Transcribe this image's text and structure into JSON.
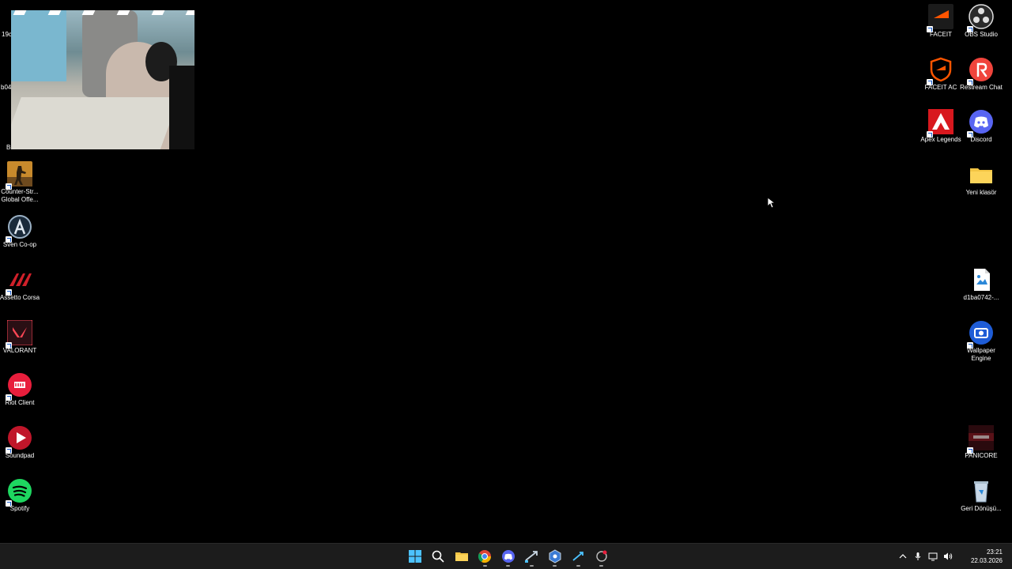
{
  "desktop": {
    "left_icons": [
      {
        "name": "counter-strike",
        "label": "Counter-Str... Global Offe..."
      },
      {
        "name": "sven-coop",
        "label": "Sven Co-op"
      },
      {
        "name": "assetto-corsa",
        "label": "Assetto Corsa"
      },
      {
        "name": "valorant",
        "label": "VALORANT"
      },
      {
        "name": "riot-client",
        "label": "Riot Client"
      },
      {
        "name": "soundpad",
        "label": "Soundpad"
      },
      {
        "name": "spotify",
        "label": "Spotify"
      }
    ],
    "partial_labels": {
      "first": "19c",
      "second": "b04",
      "third": "Br"
    },
    "right_col1": [
      {
        "name": "faceit",
        "label": "FACEIT"
      },
      {
        "name": "faceit-ac",
        "label": "FACEIT AC"
      },
      {
        "name": "apex-legends",
        "label": "Apex Legends"
      }
    ],
    "right_col2": [
      {
        "name": "obs-studio",
        "label": "OBS Studio"
      },
      {
        "name": "restream-chat",
        "label": "Restream Chat"
      },
      {
        "name": "discord",
        "label": "Discord"
      },
      {
        "name": "yeni-klasor",
        "label": "Yeni klasör"
      },
      {
        "name": "d1ba-image",
        "label": "d1ba0742-..."
      },
      {
        "name": "wallpaper-engine",
        "label": "Wallpaper Engine"
      },
      {
        "name": "panicore",
        "label": "PANICORE"
      },
      {
        "name": "recycle-bin",
        "label": "Geri Dönüşü..."
      }
    ]
  },
  "taskbar": {
    "apps": [
      "start-icon",
      "search-icon",
      "file-explorer-icon",
      "chrome-icon",
      "discord-icon",
      "steam-icon",
      "app-icon",
      "steam-icon-2",
      "faceit-ac-icon"
    ],
    "clock": {
      "time": "23:21",
      "date": "22.03.2026"
    }
  },
  "colors": {
    "taskbar_bg": "#1c1c1c",
    "desktop_bg": "#000000"
  }
}
